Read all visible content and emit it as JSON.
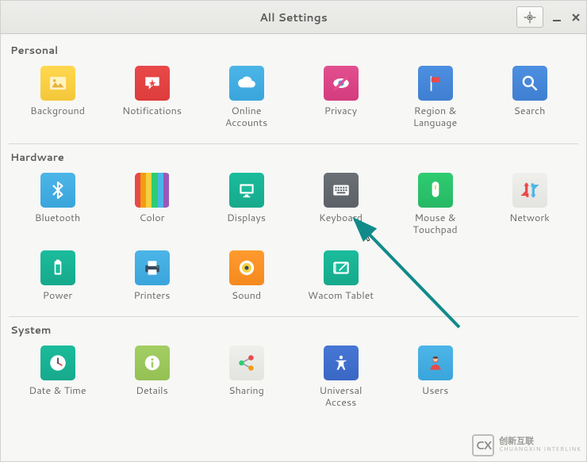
{
  "header": {
    "title": "All Settings"
  },
  "sections": {
    "personal": {
      "label": "Personal",
      "items": {
        "background": "Background",
        "notifications": "Notifications",
        "online_accounts": "Online\nAccounts",
        "privacy": "Privacy",
        "region_language": "Region &\nLanguage",
        "search": "Search"
      }
    },
    "hardware": {
      "label": "Hardware",
      "items": {
        "bluetooth": "Bluetooth",
        "color": "Color",
        "displays": "Displays",
        "keyboard": "Keyboard",
        "mouse_touchpad": "Mouse &\nTouchpad",
        "network": "Network",
        "power": "Power",
        "printers": "Printers",
        "sound": "Sound",
        "wacom_tablet": "Wacom Tablet"
      }
    },
    "system": {
      "label": "System",
      "items": {
        "date_time": "Date & Time",
        "details": "Details",
        "sharing": "Sharing",
        "universal_access": "Universal\nAccess",
        "users": "Users"
      }
    }
  },
  "watermark": {
    "brand": "创新互联",
    "sub": "CHUANGXIN INTERLINK"
  }
}
